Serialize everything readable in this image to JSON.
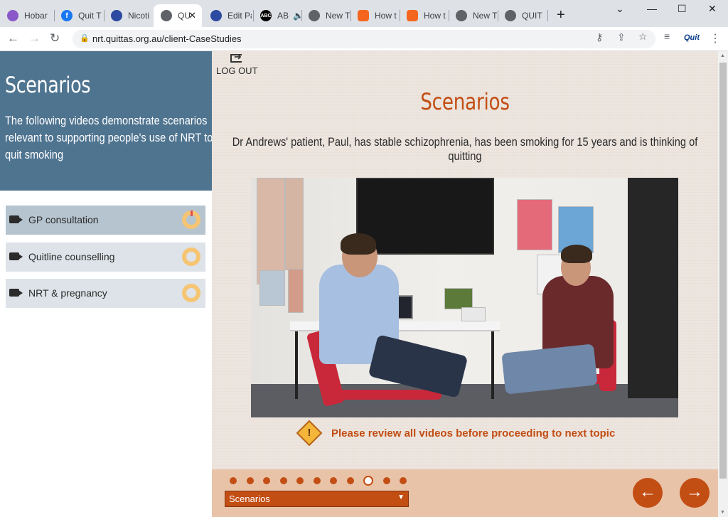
{
  "browser": {
    "tabs": [
      {
        "label": "Hobar",
        "icon": "tab-favicon",
        "color": "#8a57c9"
      },
      {
        "label": "Quit T",
        "icon": "facebook-icon",
        "color": "#1877f2"
      },
      {
        "label": "Nicoti",
        "icon": "tab-favicon",
        "color": "#2b4aa0"
      },
      {
        "label": "QU",
        "icon": "globe-icon",
        "color": "#5f6368",
        "active": true
      },
      {
        "label": "Edit Pa",
        "icon": "tab-favicon",
        "color": "#2b4aa0"
      },
      {
        "label": "AB",
        "icon": "abc-icon",
        "color": "#000000"
      },
      {
        "label": "New T",
        "icon": "globe-icon",
        "color": "#5f6368"
      },
      {
        "label": "How t",
        "icon": "chat-icon",
        "color": "#f4661f"
      },
      {
        "label": "How t",
        "icon": "chat-icon",
        "color": "#f4661f"
      },
      {
        "label": "New T",
        "icon": "globe-icon",
        "color": "#5f6368"
      },
      {
        "label": "QUIT",
        "icon": "globe-icon",
        "color": "#5f6368"
      }
    ],
    "url": "nrt.quittas.org.au/client-CaseStudies",
    "extension_label": "Quit"
  },
  "sidebar": {
    "title": "Scenarios",
    "description": "The following videos demonstrate scenarios relevant to supporting people's use of NRT to quit smoking",
    "items": [
      {
        "label": "GP consultation"
      },
      {
        "label": "Quitline counselling"
      },
      {
        "label": "NRT & pregnancy"
      }
    ]
  },
  "main": {
    "logout_label": "LOG OUT",
    "title": "Scenarios",
    "description": "Dr Andrews' patient, Paul, has stable schizophrenia, has been smoking for 15 years and is thinking of quitting",
    "notice": "Please review all videos before proceeding to next topic",
    "notice_icon": "!"
  },
  "footer": {
    "topic": "Scenarios",
    "page_total": 11,
    "page_current": 9,
    "prev_icon": "←",
    "next_icon": "→"
  },
  "colors": {
    "accent": "#c24e14",
    "sidebar_header": "#4f7490",
    "ring": "#f6c573"
  }
}
